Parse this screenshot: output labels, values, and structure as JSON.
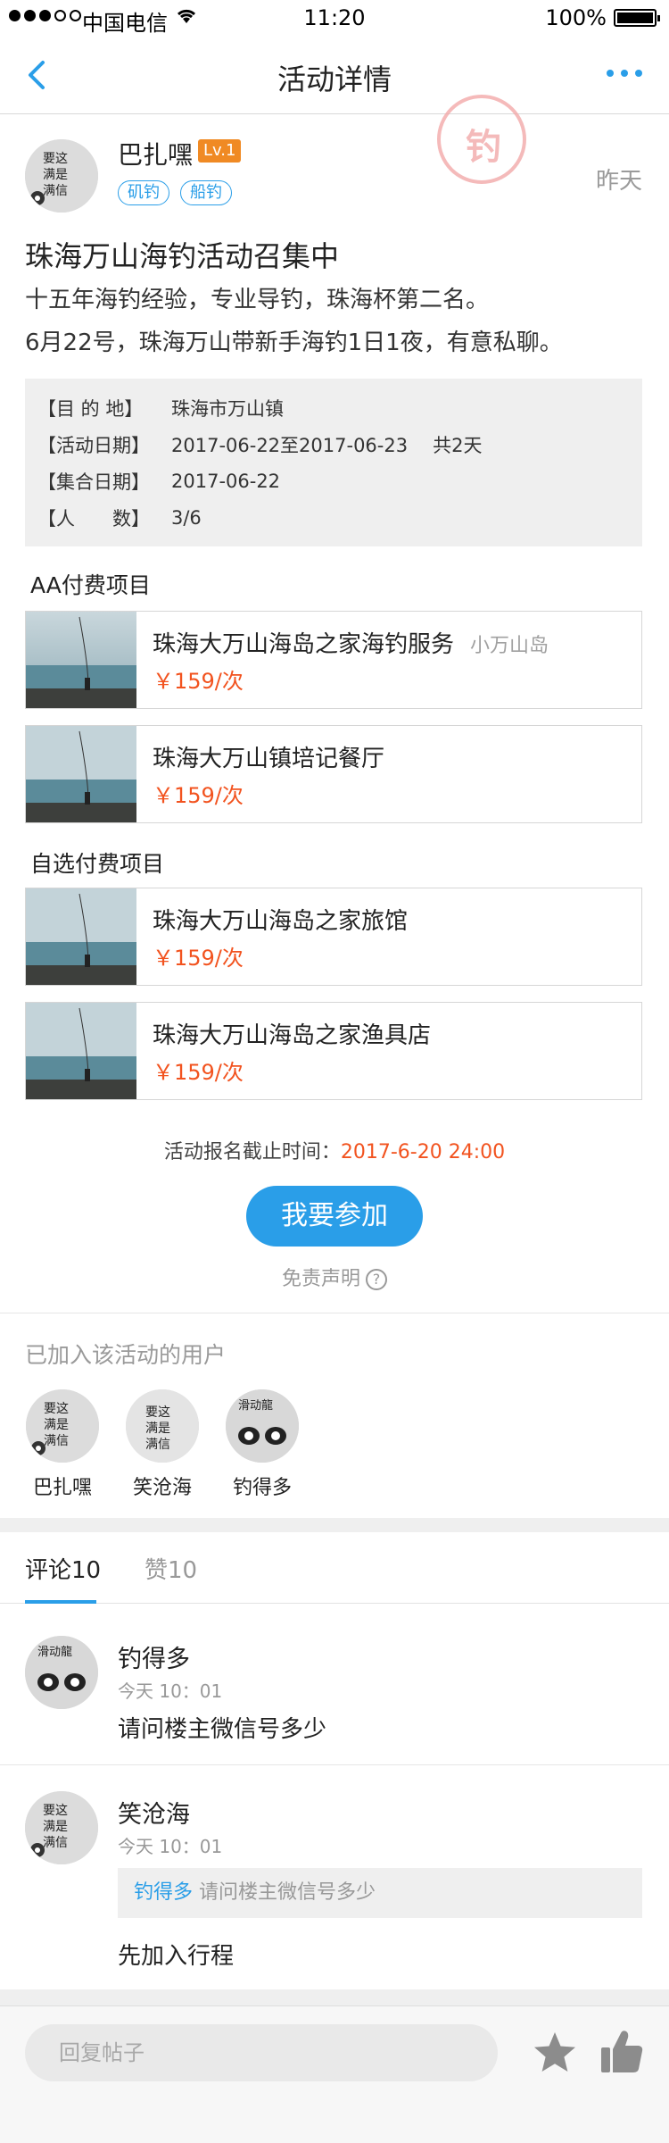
{
  "status_bar": {
    "carrier": "中国电信",
    "time": "11:20",
    "battery": "100%"
  },
  "nav": {
    "title": "活动详情"
  },
  "post": {
    "author": "巴扎嘿",
    "level": "Lv.1",
    "tags": [
      "矶钓",
      "船钓"
    ],
    "time": "昨天",
    "title": "珠海万山海钓活动召集中",
    "body_line1": "十五年海钓经验，专业导钓，珠海杯第二名。",
    "body_line2": "6月22号，珠海万山带新手海钓1日1夜，有意私聊。"
  },
  "info": {
    "destination_key": "【目 的 地】",
    "destination": "珠海市万山镇",
    "date_key": "【活动日期】",
    "date": "2017-06-22至2017-06-23",
    "duration": "共2天",
    "meet_key": "【集合日期】",
    "meet": "2017-06-22",
    "people_key": "【人　　数】",
    "people": "3/6"
  },
  "aa_section": {
    "title": "AA付费项目"
  },
  "aa_items": [
    {
      "name": "珠海大万山海岛之家海钓服务",
      "loc": "小万山岛",
      "price": "￥159/次"
    },
    {
      "name": "珠海大万山镇培记餐厅",
      "loc": "",
      "price": "￥159/次"
    }
  ],
  "optional_section": {
    "title": "自选付费项目"
  },
  "optional_items": [
    {
      "name": "珠海大万山海岛之家旅馆",
      "price": "￥159/次"
    },
    {
      "name": "珠海大万山海岛之家渔具店",
      "price": "￥159/次"
    }
  ],
  "signup": {
    "deadline_label": "活动报名截止时间：",
    "deadline_value": "2017-6-20 24:00",
    "join_button": "我要参加",
    "disclaimer": "免责声明",
    "disclaimer_icon": "?"
  },
  "joined": {
    "title": "已加入该活动的用户",
    "users": [
      "巴扎嘿",
      "笑沧海",
      "钓得多"
    ]
  },
  "tabs": {
    "comments": "评论10",
    "likes": "赞10"
  },
  "comments": [
    {
      "name": "钓得多",
      "time": "今天 10：01",
      "text": "请问楼主微信号多少"
    },
    {
      "name": "笑沧海",
      "time": "今天 10：01",
      "quote_user": "钓得多",
      "quote_text": "请问楼主微信号多少",
      "text": "先加入行程"
    }
  ],
  "reply": {
    "placeholder": "回复帖子"
  },
  "stamp": {
    "text": "钓"
  },
  "colors": {
    "accent": "#2a9ee8",
    "price": "#f2531f",
    "level": "#f08a24"
  },
  "icons": [
    "back-icon",
    "more-icon",
    "wifi-icon",
    "battery-icon",
    "question-icon",
    "star-icon",
    "thumb-up-icon"
  ]
}
